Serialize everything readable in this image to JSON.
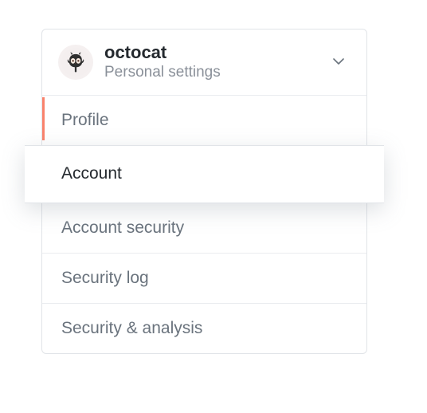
{
  "header": {
    "username": "octocat",
    "subtitle": "Personal settings"
  },
  "nav": {
    "items": [
      {
        "label": "Profile",
        "current": true,
        "highlight": false
      },
      {
        "label": "Account",
        "current": false,
        "highlight": true
      },
      {
        "label": "Account security",
        "current": false,
        "highlight": false
      },
      {
        "label": "Security log",
        "current": false,
        "highlight": false
      },
      {
        "label": "Security & analysis",
        "current": false,
        "highlight": false
      }
    ]
  }
}
